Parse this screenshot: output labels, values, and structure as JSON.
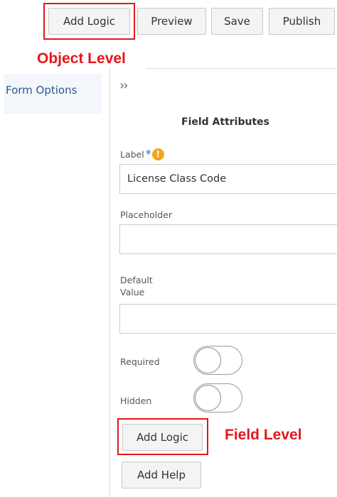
{
  "toolbar": {
    "add_logic_label": "Add Logic",
    "preview_label": "Preview",
    "save_label": "Save",
    "publish_label": "Publish"
  },
  "annotations": {
    "object_level": "Object Level",
    "field_level": "Field Level",
    "color": "#e4161c"
  },
  "sidebar": {
    "form_options_label": "Form Options"
  },
  "panel": {
    "collapse_icon": "double-chevron-right-icon",
    "section_title": "Field Attributes"
  },
  "fields": {
    "label": {
      "label": "Label",
      "required_marker": "*",
      "warning_icon": "!",
      "value": "License Class Code"
    },
    "placeholder": {
      "label": "Placeholder",
      "value": ""
    },
    "default_value": {
      "label": "Default Value",
      "value": ""
    },
    "required": {
      "label": "Required",
      "on": false
    },
    "hidden": {
      "label": "Hidden",
      "on": false
    }
  },
  "field_actions": {
    "add_logic_label": "Add Logic",
    "add_help_label": "Add Help"
  }
}
